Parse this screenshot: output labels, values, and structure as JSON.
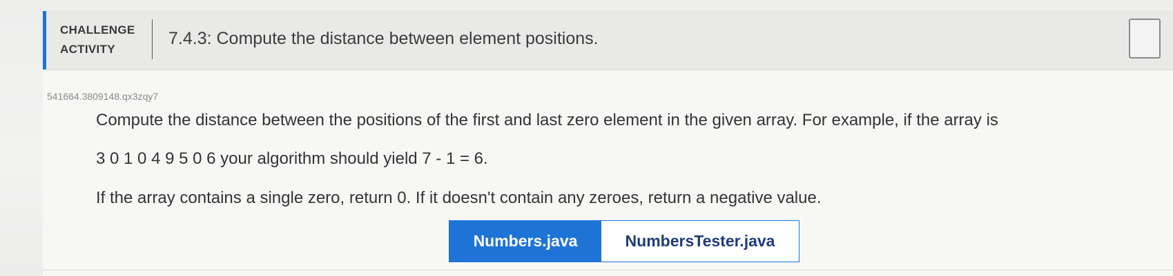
{
  "header": {
    "label_line1": "CHALLENGE",
    "label_line2": "ACTIVITY",
    "title": "7.4.3: Compute the distance between element positions."
  },
  "activity_code": "541664.3809148.qx3zqy7",
  "instructions": {
    "line1": "Compute the distance between the positions of the first and last zero element in the given array. For example, if the array is",
    "line2": "3 0 1 0 4 9 5 0 6 your algorithm should yield 7 - 1 = 6.",
    "line3": "If the array contains a single zero, return 0. If it doesn't contain any zeroes, return a negative value."
  },
  "tabs": [
    {
      "label": "Numbers.java",
      "active": true
    },
    {
      "label": "NumbersTester.java",
      "active": false
    }
  ],
  "colors": {
    "accent": "#1e74d6",
    "tab_inactive_text": "#1f3b7a"
  },
  "icons": {
    "completion": "completion-box-icon"
  }
}
